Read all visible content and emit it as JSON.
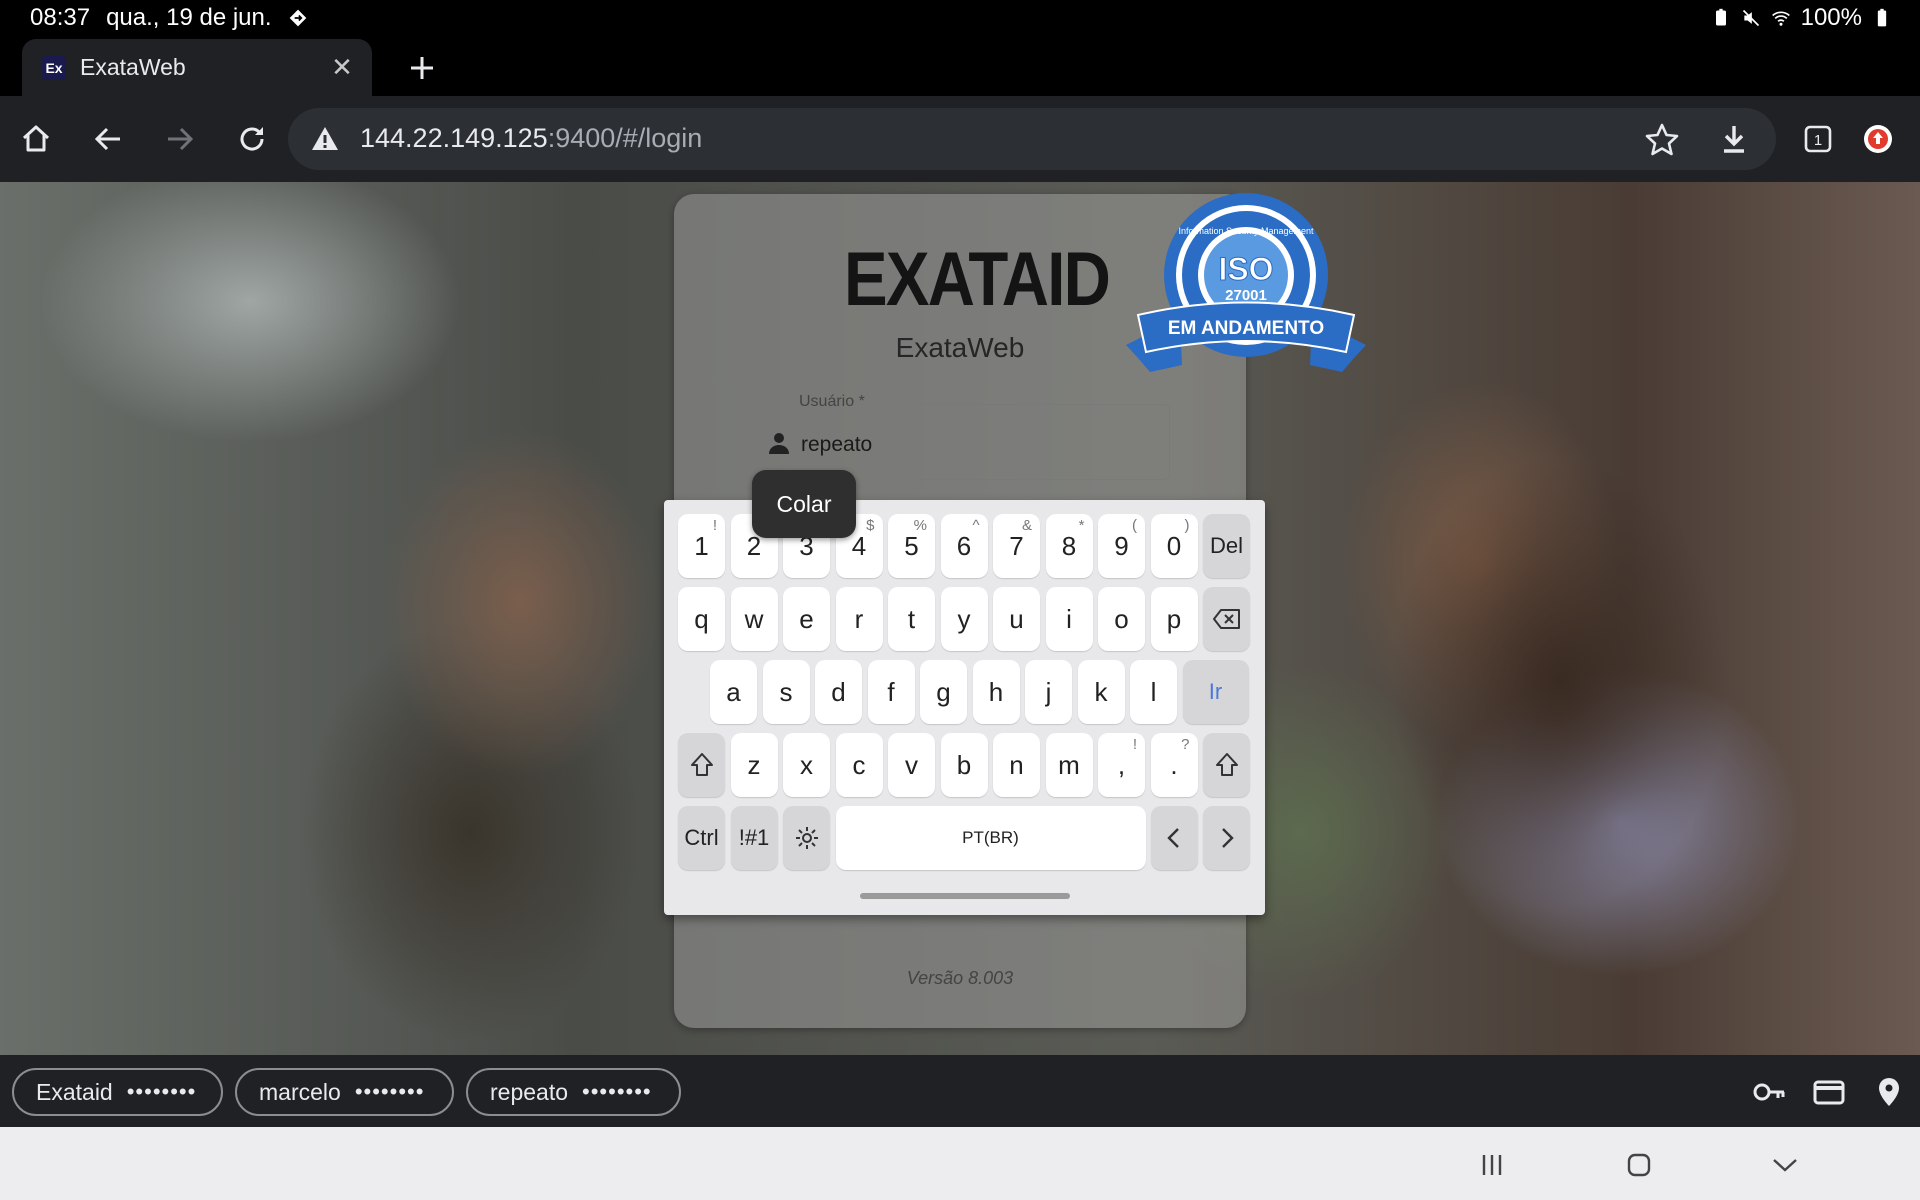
{
  "status_bar": {
    "time": "08:37",
    "date": "qua., 19 de jun.",
    "battery": "100%"
  },
  "tab": {
    "favicon_text": "Ex",
    "title": "ExataWeb"
  },
  "toolbar": {
    "url_host": "144.22.149.125",
    "url_rest": ":9400/#/login",
    "tab_count": "1"
  },
  "login": {
    "logo_text": "EXATAID",
    "app_name": "ExataWeb",
    "user_label": "Usuário *",
    "user_value": "repeato",
    "version": "Versão 8.003",
    "badge_top_text": "Information Security Management",
    "badge_iso": "ISO",
    "badge_number": "27001",
    "badge_ribbon": "EM ANDAMENTO"
  },
  "paste_popup": {
    "label": "Colar"
  },
  "keyboard": {
    "row1": [
      {
        "k": "1",
        "s": "!"
      },
      {
        "k": "2",
        "s": "@"
      },
      {
        "k": "3",
        "s": "#"
      },
      {
        "k": "4",
        "s": "$"
      },
      {
        "k": "5",
        "s": "%"
      },
      {
        "k": "6",
        "s": "^"
      },
      {
        "k": "7",
        "s": "&"
      },
      {
        "k": "8",
        "s": "*"
      },
      {
        "k": "9",
        "s": "("
      },
      {
        "k": "0",
        "s": ")"
      }
    ],
    "del": "Del",
    "row2": [
      "q",
      "w",
      "e",
      "r",
      "t",
      "y",
      "u",
      "i",
      "o",
      "p"
    ],
    "row3": [
      "a",
      "s",
      "d",
      "f",
      "g",
      "h",
      "j",
      "k",
      "l"
    ],
    "go": "Ir",
    "row4": [
      "z",
      "x",
      "c",
      "v",
      "b",
      "n",
      "m"
    ],
    "comma": ",",
    "comma_sup": "!",
    "period": ".",
    "period_sup": "?",
    "ctrl": "Ctrl",
    "symbols": "!#1",
    "space": "PT(BR)"
  },
  "autofill": {
    "chips": [
      {
        "user": "Exataid",
        "mask": "••••••••"
      },
      {
        "user": "marcelo",
        "mask": "••••••••"
      },
      {
        "user": "repeato",
        "mask": "••••••••"
      }
    ]
  },
  "colors": {
    "accent_go": "#4a7ad8",
    "badge_blue": "#2b6cc4"
  }
}
